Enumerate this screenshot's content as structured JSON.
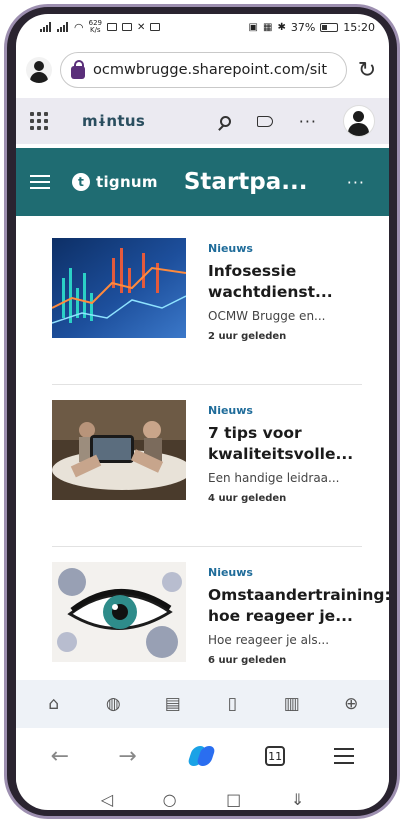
{
  "status_bar": {
    "speed_top": "629",
    "speed_unit": "K/s",
    "battery": "37%",
    "time": "15:20"
  },
  "browser": {
    "url": "ocmwbrugge.sharepoint.com/sit",
    "reload_icon": "reload-icon"
  },
  "sharepoint_bar": {
    "brand": "mɨntus"
  },
  "site_header": {
    "logo_letter": "t",
    "logo_text": "tignum",
    "title": "Startpa...",
    "more": "···"
  },
  "news": [
    {
      "category": "Nieuws",
      "title": "Infosessie wachtdienst...",
      "description": "OCMW Brugge en...",
      "time": "2 uur geleden"
    },
    {
      "category": "Nieuws",
      "title": "7 tips voor kwaliteitsvolle...",
      "description": "Een handige leidraa...",
      "time": "4 uur geleden"
    },
    {
      "category": "Nieuws",
      "title": "Omstaandertraining: hoe reageer je...",
      "description": "Hoe reageer je als...",
      "time": "6 uur geleden"
    }
  ],
  "toolbar": {
    "tab_count": "11"
  },
  "colors": {
    "teal_header": "#1f6c72",
    "sharepoint_bar": "#ebeaf1",
    "category_blue": "#1f6c9a"
  }
}
